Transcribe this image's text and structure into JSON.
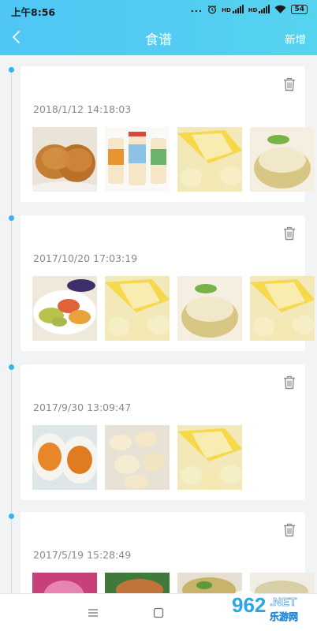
{
  "status": {
    "time": "上午8:56",
    "indicators": "...",
    "net1": "HD",
    "net2": "HD",
    "battery": "54"
  },
  "header": {
    "title": "食谱",
    "action": "新增",
    "back_icon": "chevron-left-icon"
  },
  "recipes": [
    {
      "date": "2018/1/12 14:18:03",
      "photos": [
        "fried-chicken",
        "yogurt-bottles",
        "banana",
        "pomelo"
      ]
    },
    {
      "date": "2017/10/20 17:03:19",
      "photos": [
        "dried-fruit-plate",
        "banana",
        "pomelo",
        "banana"
      ]
    },
    {
      "date": "2017/9/30 13:09:47",
      "photos": [
        "salted-egg",
        "snack-knots",
        "banana"
      ]
    },
    {
      "date": "2017/5/19 15:28:49",
      "photos": [
        "pink-flower",
        "roast-dish",
        "noodle-soup",
        "soup-bowl"
      ]
    }
  ],
  "watermark": {
    "brand": "962",
    "suffix": ".NET",
    "sub": "乐游网"
  },
  "colors": {
    "accent": "#35b3ef",
    "header_start": "#4fc6f4",
    "header_end": "#56d4ef"
  }
}
